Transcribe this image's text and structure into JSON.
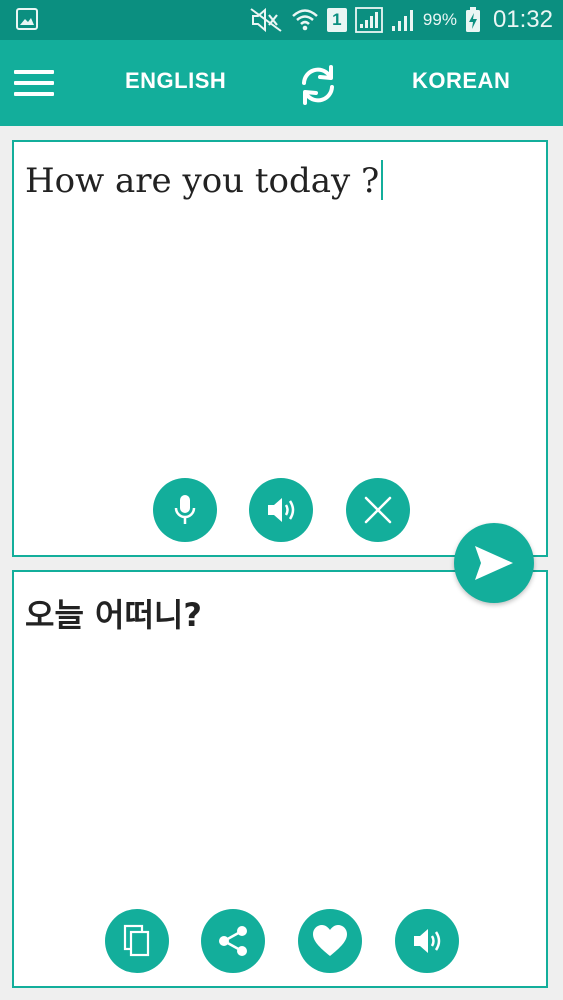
{
  "status_bar": {
    "battery_percent": "99%",
    "time": "01:32",
    "sim_slot": "1",
    "icons": [
      "gallery-notification-icon",
      "mute-icon",
      "wifi-icon",
      "sim-icon",
      "signal-icon",
      "battery-charging-icon"
    ]
  },
  "app_bar": {
    "source_language": "ENGLISH",
    "target_language": "KOREAN",
    "icons": [
      "menu-icon",
      "swap-icon"
    ]
  },
  "input_panel": {
    "text": "How are you today ?",
    "buttons": [
      "microphone-icon",
      "speaker-icon",
      "close-icon"
    ]
  },
  "output_panel": {
    "text": "오늘 어떠니?",
    "buttons": [
      "copy-icon",
      "share-icon",
      "heart-icon",
      "speaker-icon"
    ]
  },
  "send_button": {
    "icon": "send-icon"
  },
  "colors": {
    "status_bar": "#0b8f80",
    "accent": "#13ae9b",
    "background": "#efefef",
    "panel": "#ffffff",
    "text": "#222222"
  }
}
